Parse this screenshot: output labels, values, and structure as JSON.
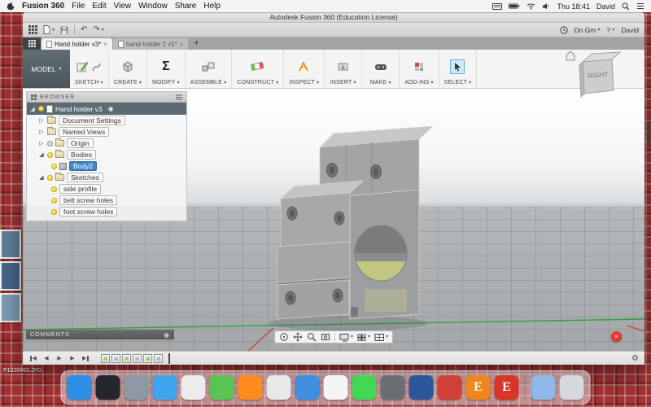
{
  "theme": {
    "selection_blue": "#3f86c9",
    "root_row_bg": "#5c6a74",
    "axis_green": "#35a03c",
    "axis_red": "#cf4433",
    "ribbon_select_bg": "#cfe9f7"
  },
  "icons": {
    "caret_down": "▾",
    "close": "×",
    "undo": "↶",
    "redo": "↷",
    "gear": "⚙",
    "record_dot": "◉",
    "expanded_tri": "◢",
    "collapsed_tri": "▷",
    "play": "▶",
    "back": "◀",
    "help": "?"
  },
  "menu_bar": {
    "app_name": "Fusion 360",
    "items": [
      "File",
      "Edit",
      "View",
      "Window",
      "Share",
      "Help"
    ],
    "time": "Thu 18:41",
    "user": "David"
  },
  "window": {
    "title": "Autodesk Fusion 360 (Education License)",
    "account_label": "Dn Gm"
  },
  "tabs": {
    "active_label": "Hand holder v3*",
    "inactive_label": "hand holder 2 v1*",
    "new_tab_label": "+"
  },
  "ribbon": {
    "workspace_label": "MODEL",
    "groups": [
      "SKETCH",
      "CREATE",
      "MODIFY",
      "ASSEMBLE",
      "CONSTRUCT",
      "INSPECT",
      "INSERT",
      "MAKE",
      "ADD-INS",
      "SELECT"
    ],
    "modify_glyph": "Σ"
  },
  "browser": {
    "header_label": "BROWSER",
    "root_label": "Hand holder v3",
    "items": {
      "document_settings": "Document Settings",
      "named_views": "Named Views",
      "origin": "Origin",
      "bodies": "Bodies",
      "body2": "Body2",
      "sketches": "Sketches",
      "sketch1": "side profile",
      "sketch2": "belt screw holes",
      "sketch3": "foot screw holes"
    }
  },
  "viewcube": {
    "face_label": "RIGHT"
  },
  "canvas": {
    "comments_label": "COMMENTS"
  },
  "timeline": {
    "features": [
      "sketch",
      "feature",
      "sketch",
      "feature",
      "sketch",
      "feature"
    ]
  },
  "desktop": {
    "file_label": "P1020463.JPG"
  },
  "dock": {
    "apps": [
      {
        "name": "finder",
        "color": "#2f8fe5"
      },
      {
        "name": "siri",
        "color": "#26262e"
      },
      {
        "name": "launchpad",
        "color": "#8e98a3"
      },
      {
        "name": "safari",
        "color": "#3fa6ee"
      },
      {
        "name": "photos",
        "color": "#ececec"
      },
      {
        "name": "maps",
        "color": "#58c452"
      },
      {
        "name": "vlc",
        "color": "#ff8a1e"
      },
      {
        "name": "chrome",
        "color": "#e8e8e8"
      },
      {
        "name": "mail",
        "color": "#3f8fe0"
      },
      {
        "name": "calendar",
        "color": "#f5f5f5"
      },
      {
        "name": "messages",
        "color": "#43d854"
      },
      {
        "name": "gimp",
        "color": "#6b6f74"
      },
      {
        "name": "word",
        "color": "#2b579a"
      },
      {
        "name": "app-red",
        "color": "#d04038"
      },
      {
        "name": "stack-e-orange",
        "color": "#f0861d",
        "glyph": "E"
      },
      {
        "name": "stack-e-red",
        "color": "#d8352a",
        "glyph": "E"
      },
      {
        "name": "divider"
      },
      {
        "name": "downloads-folder",
        "color": "#8fb7e8"
      },
      {
        "name": "trash",
        "color": "#d5d8dc"
      }
    ]
  }
}
